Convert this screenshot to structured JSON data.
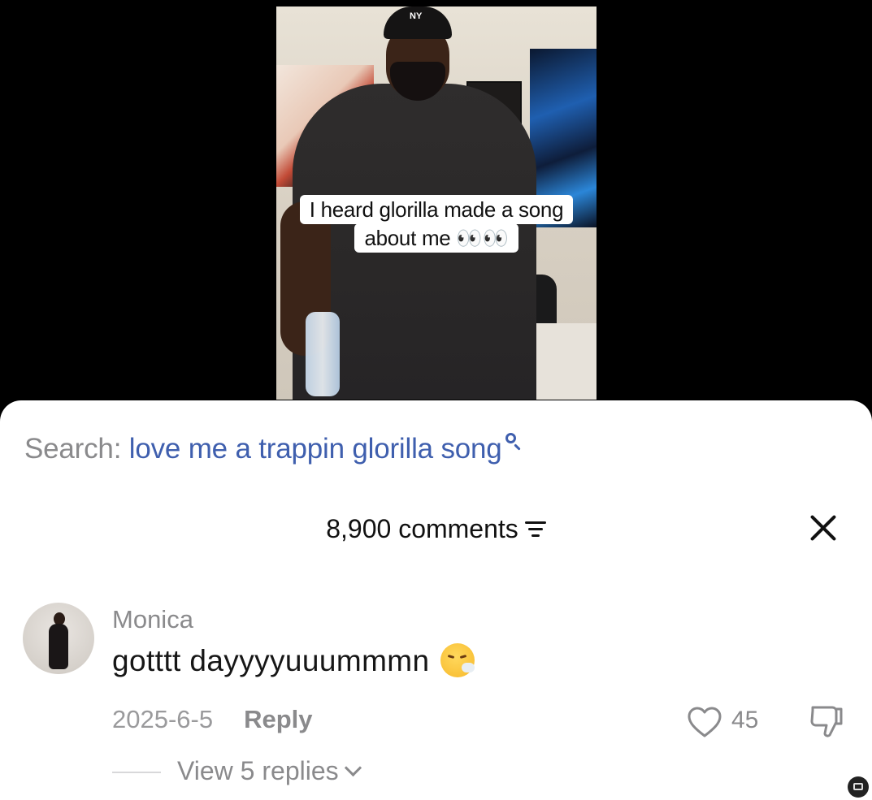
{
  "video": {
    "caption_line1": "I heard glorilla made a song",
    "caption_line2": "about me 👀👀",
    "cap_logo": "NY"
  },
  "search": {
    "prefix": "Search:",
    "query": "love me a trappin glorilla song",
    "icon": "search-icon"
  },
  "comments_header": {
    "count_label": "8,900 comments",
    "sort_icon": "sort-icon",
    "close_icon": "close-icon"
  },
  "comment": {
    "username": "Monica",
    "text": "gotttt dayyyyuuummmn",
    "emoji": "face-exhaling",
    "date": "2025-6-5",
    "reply_label": "Reply",
    "like_count": "45",
    "view_replies_label": "View 5 replies"
  },
  "colors": {
    "search_query": "#3f5fae",
    "muted_text": "#8a8a8c",
    "sheet_bg": "#ffffff",
    "backdrop": "#000000"
  }
}
